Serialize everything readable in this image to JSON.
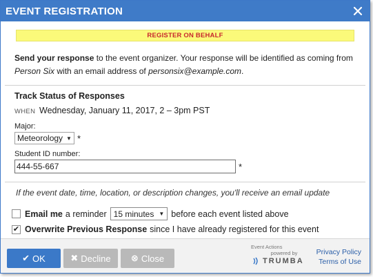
{
  "dialog": {
    "title": "EVENT REGISTRATION"
  },
  "banner": "REGISTER ON BEHALF",
  "response": {
    "bold": "Send your response",
    "text1": " to the event organizer. Your response will be identified as coming from",
    "person": "Person Six",
    "text2": " with an email address of ",
    "email": "personsix@example.com",
    "end": "."
  },
  "event": {
    "name": "Track Status of Responses",
    "when_label": "WHEN",
    "when_value": "Wednesday, January 11, 2017, 2 – 3pm PST"
  },
  "fields": {
    "major_label": "Major:",
    "major_value": "Meteorology",
    "student_id_label": "Student ID number:",
    "student_id_value": "444-55-667",
    "required_mark": "*"
  },
  "notice": "If the event date, time, location, or description changes, you'll receive an email update",
  "options": {
    "email_bold": "Email me",
    "email_text1": "a reminder",
    "reminder_value": "15 minutes",
    "email_text2": "before each event listed above",
    "email_checked": false,
    "overwrite_bold": "Overwrite Previous Response",
    "overwrite_text": "since I have already registered for this event",
    "overwrite_checked": true
  },
  "buttons": {
    "ok": "OK",
    "decline": "Decline",
    "close": "Close"
  },
  "brand": {
    "line1": "Event Actions",
    "line2": "powered by",
    "logo": "TRUMBA"
  },
  "links": {
    "privacy": "Privacy Policy",
    "terms": "Terms of Use"
  },
  "colors": {
    "title_bar": "#3f7bc8",
    "banner_bg": "#fbfa7a",
    "banner_text": "#c8282d",
    "primary_button": "#3b79c8",
    "disabled_button": "#b9b9b9"
  }
}
